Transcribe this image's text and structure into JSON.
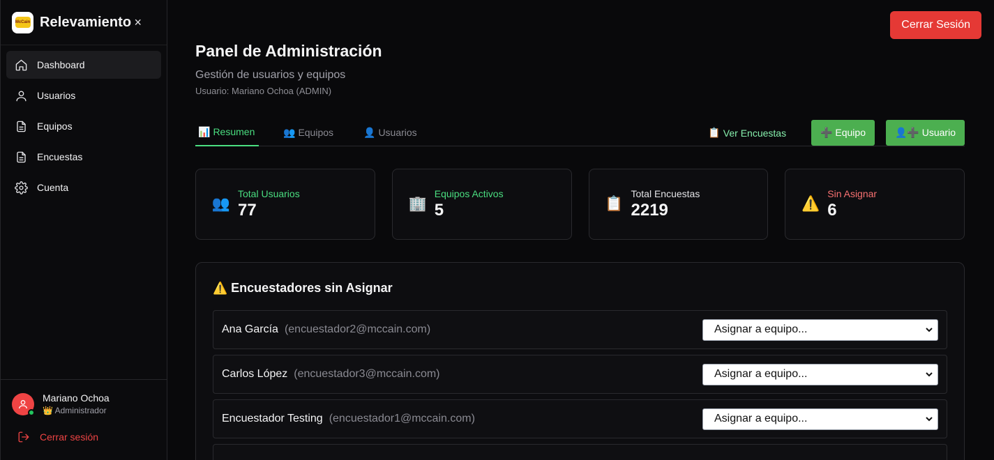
{
  "sidebar": {
    "brand": "Relevamiento",
    "logo_text": "McCain",
    "close": "×",
    "items": [
      {
        "label": "Dashboard",
        "icon": "home-icon",
        "active": true
      },
      {
        "label": "Usuarios",
        "icon": "user-icon"
      },
      {
        "label": "Equipos",
        "icon": "document-icon"
      },
      {
        "label": "Encuestas",
        "icon": "document-icon"
      },
      {
        "label": "Cuenta",
        "icon": "gear-icon"
      }
    ],
    "user": {
      "name": "Mariano Ochoa",
      "role": "👑 Administrador",
      "status_color": "#22c55e"
    },
    "logout": "Cerrar sesión"
  },
  "header": {
    "logout_button": "Cerrar Sesión",
    "title": "Panel de Administración",
    "subtitle": "Gestión de usuarios y equipos",
    "user_line": "Usuario: Mariano Ochoa (ADMIN)"
  },
  "tabs": [
    {
      "icon": "📊",
      "label": "Resumen",
      "active": true
    },
    {
      "icon": "👥",
      "label": "Equipos"
    },
    {
      "icon": "👤",
      "label": "Usuarios"
    }
  ],
  "actions": {
    "ver_encuestas": "Ver Encuestas",
    "ver_encuestas_icon": "📋",
    "add_equipo": "➕ Equipo",
    "add_usuario": "👤➕ Usuario"
  },
  "stats": [
    {
      "icon": "👥",
      "label": "Total Usuarios",
      "value": "77",
      "color": "#4ade80"
    },
    {
      "icon": "🏢",
      "label": "Equipos Activos",
      "value": "5",
      "color": "#4ade80"
    },
    {
      "icon": "📋",
      "label": "Total Encuestas",
      "value": "2219",
      "color": "#e4e4e7"
    },
    {
      "icon": "⚠️",
      "label": "Sin Asignar",
      "value": "6",
      "color": "#f87171"
    }
  ],
  "unassigned": {
    "icon": "⚠️",
    "title": "Encuestadores sin Asignar",
    "rows": [
      {
        "name": "Ana García",
        "email": "(encuestador2@mccain.com)",
        "select": "Asignar a equipo..."
      },
      {
        "name": "Carlos López",
        "email": "(encuestador3@mccain.com)",
        "select": "Asignar a equipo..."
      },
      {
        "name": "Encuestador Testing",
        "email": "(encuestador1@mccain.com)",
        "select": "Asignar a equipo..."
      },
      {
        "name": "",
        "email": "",
        "select": ""
      }
    ]
  },
  "colors": {
    "accent_green": "#4ade80",
    "button_green": "#4caf50",
    "danger": "#e53935"
  }
}
